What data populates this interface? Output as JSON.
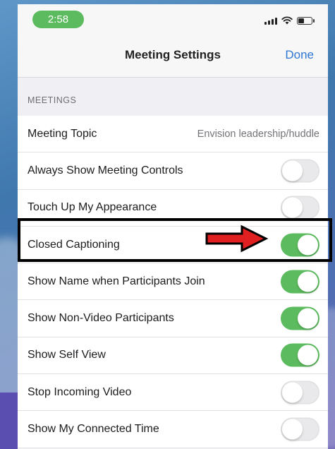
{
  "status_bar": {
    "time": "2:58",
    "icons": [
      "signal-icon",
      "wifi-icon",
      "battery-icon"
    ]
  },
  "nav": {
    "title": "Meeting Settings",
    "done_label": "Done"
  },
  "section": {
    "header": "MEETINGS"
  },
  "rows": [
    {
      "label": "Meeting Topic",
      "value": "Envision leadership/huddle"
    },
    {
      "label": "Always Show Meeting Controls",
      "toggle": false
    },
    {
      "label": "Touch Up My Appearance",
      "toggle": false
    },
    {
      "label": "Closed Captioning",
      "toggle": true
    },
    {
      "label": "Show Name when Participants Join",
      "toggle": true
    },
    {
      "label": "Show Non-Video Participants",
      "toggle": true
    },
    {
      "label": "Show Self View",
      "toggle": true
    },
    {
      "label": "Stop Incoming Video",
      "toggle": false
    },
    {
      "label": "Show My Connected Time",
      "toggle": false
    }
  ],
  "colors": {
    "toggle_on": "#5cbb5e",
    "accent_link": "#2f77d6",
    "annotation_arrow": "#e02020"
  }
}
